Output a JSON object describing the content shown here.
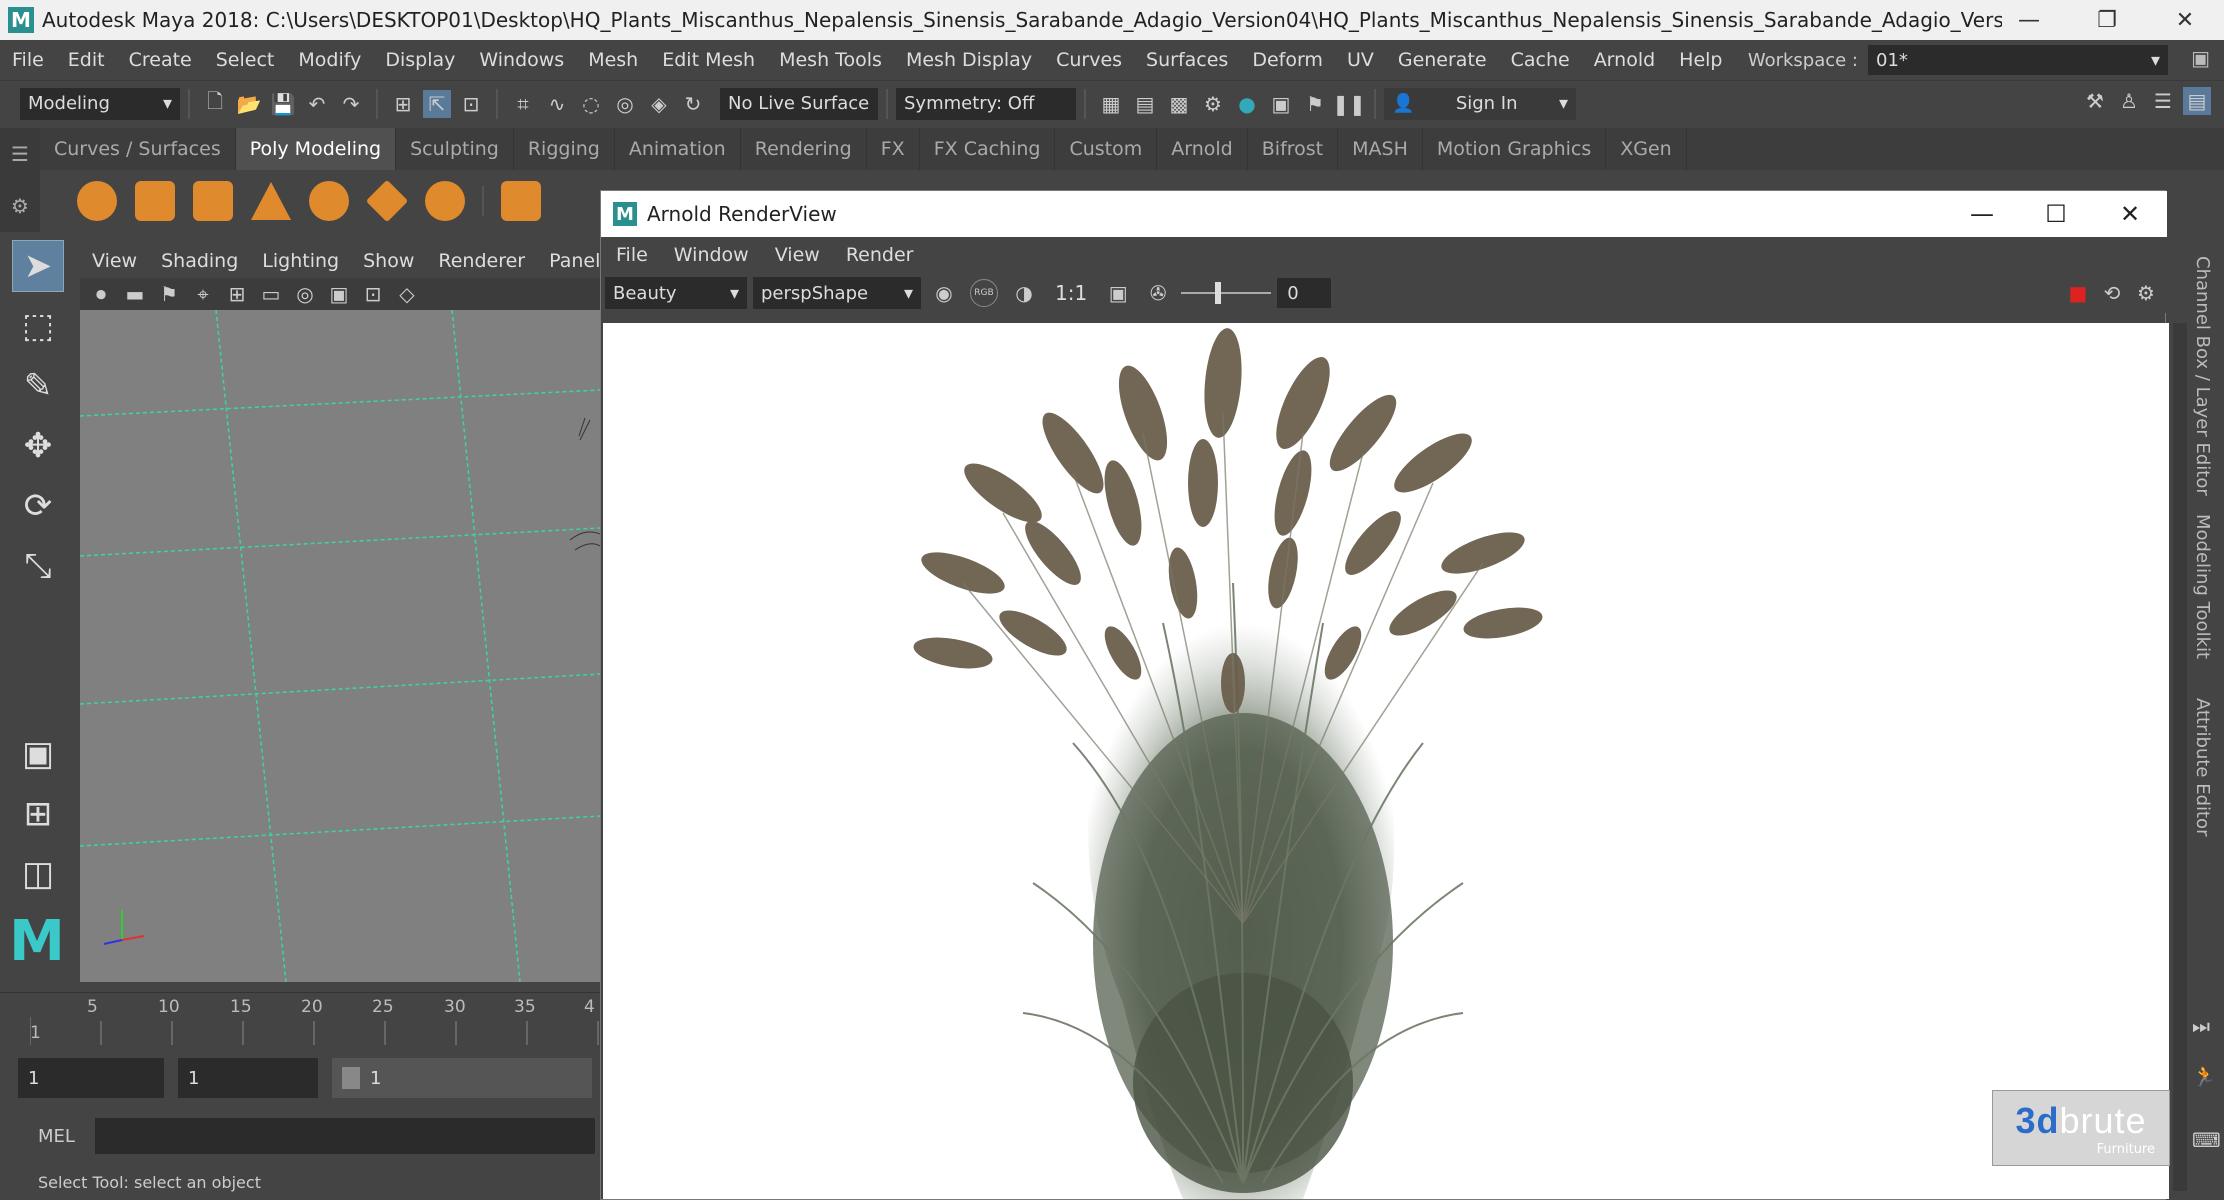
{
  "window": {
    "title": "Autodesk Maya 2018: C:\\Users\\DESKTOP01\\Desktop\\HQ_Plants_Miscanthus_Nepalensis_Sinensis_Sarabande_Adagio_Version04\\HQ_Plants_Miscanthus_Nepalensis_Sinensis_Sarabande_Adagio_Version04\\HQ_Plants_Miscanthus_...",
    "logo": "M"
  },
  "menu": [
    "File",
    "Edit",
    "Create",
    "Select",
    "Modify",
    "Display",
    "Windows",
    "Mesh",
    "Edit Mesh",
    "Mesh Tools",
    "Mesh Display",
    "Curves",
    "Surfaces",
    "Deform",
    "UV",
    "Generate",
    "Cache",
    "Arnold",
    "Help"
  ],
  "workspace": {
    "label": "Workspace :",
    "value": "01*"
  },
  "statusline": {
    "mode": "Modeling",
    "live_surface": "No Live Surface",
    "symmetry": "Symmetry: Off",
    "sign_in": "Sign In"
  },
  "shelf_tabs": [
    "Curves / Surfaces",
    "Poly Modeling",
    "Sculpting",
    "Rigging",
    "Animation",
    "Rendering",
    "FX",
    "FX Caching",
    "Custom",
    "Arnold",
    "Bifrost",
    "MASH",
    "Motion Graphics",
    "XGen"
  ],
  "shelf_active": "Poly Modeling",
  "viewport": {
    "menu": [
      "View",
      "Shading",
      "Lighting",
      "Show",
      "Renderer",
      "Panels"
    ]
  },
  "timeslider": {
    "ticks": [
      "1",
      "5",
      "10",
      "15",
      "20",
      "25",
      "30",
      "35",
      "4"
    ]
  },
  "range": {
    "start": "1",
    "current": "1",
    "end": "1"
  },
  "cmdline": {
    "lang": "MEL"
  },
  "helpline": "Select Tool: select an object",
  "rightbar": [
    "Channel Box / Layer Editor",
    "Modeling Toolkit",
    "Attribute Editor"
  ],
  "arnold": {
    "title": "Arnold RenderView",
    "logo": "M",
    "menu": [
      "File",
      "Window",
      "View",
      "Render"
    ],
    "aov": "Beauty",
    "camera": "perspShape",
    "rgb": "RGB",
    "zoom": "1:1",
    "exposure": "0"
  },
  "watermark": {
    "brand_a": "3d",
    "brand_b": "brute",
    "sub": "Furniture"
  },
  "colors": {
    "accent": "#e08a2e",
    "teal": "#2aa58a",
    "maya": "#2a8f8f"
  }
}
